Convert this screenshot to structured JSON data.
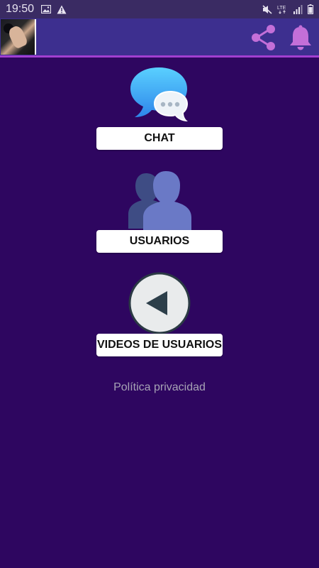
{
  "status_bar": {
    "time": "19:50",
    "network": "LTE",
    "icons": [
      "image-icon",
      "warning-icon",
      "mute-icon",
      "lte-icon",
      "signal-icon",
      "battery-icon"
    ]
  },
  "app_bar": {
    "avatar": "profile-photo",
    "actions": [
      "share-icon",
      "bell-icon"
    ],
    "accent_color": "#a13fd0",
    "icon_color": "#c36fd8"
  },
  "menu": {
    "chat_label": "CHAT",
    "usuarios_label": "USUARIOS",
    "videos_label": "VIDEOS DE USUARIOS",
    "privacy_label": "Política privacidad"
  },
  "colors": {
    "background": "#2e0660",
    "app_bar": "#3d2f8f",
    "status_bar": "#3a2b63",
    "button_bg": "#ffffff"
  }
}
